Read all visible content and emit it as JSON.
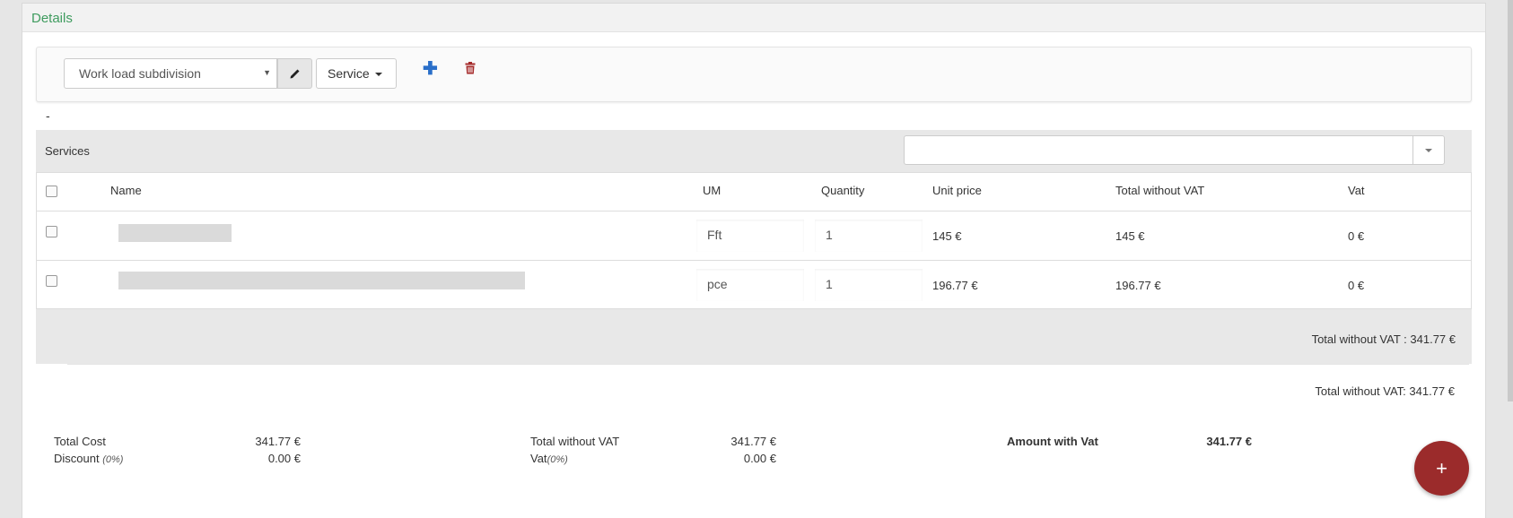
{
  "panel": {
    "title": "Details"
  },
  "toolbar": {
    "select_value": "Work load subdivision",
    "service_label": "Service",
    "icons": [
      "pencil-icon",
      "plus-icon",
      "trash-icon",
      "chevron-down-icon"
    ]
  },
  "dash": "-",
  "services": {
    "label": "Services",
    "search_value": ""
  },
  "table": {
    "headers": {
      "name": "Name",
      "um": "UM",
      "quantity": "Quantity",
      "unit_price": "Unit price",
      "total_without_vat": "Total without VAT",
      "vat": "Vat"
    },
    "rows": [
      {
        "um": "Fft",
        "quantity": "1",
        "unit_price": "145 €",
        "total": "145 €",
        "vat": "0 €"
      },
      {
        "um": "pce",
        "quantity": "1",
        "unit_price": "196.77 €",
        "total": "196.77 €",
        "vat": "0 €"
      }
    ]
  },
  "band_total": "Total without VAT : 341.77 €",
  "total_line2": "Total without VAT: 341.77 €",
  "summary": {
    "total_cost_label": "Total Cost",
    "total_cost_value": "341.77 €",
    "discount_label": "Discount",
    "discount_pct": "(0%)",
    "discount_value": "0.00 €",
    "total_wo_vat_label": "Total without VAT",
    "total_wo_vat_value": "341.77 €",
    "vat_label": "Vat",
    "vat_pct": "(0%)",
    "vat_value": "0.00 €",
    "amount_with_vat_label": "Amount with Vat",
    "amount_with_vat_value": "341.77 €"
  },
  "fab_label": "+",
  "colors": {
    "title_green": "#3f9c5f",
    "plus_blue": "#2a6fc9",
    "trash_red": "#a52a2a",
    "fab_red": "#9b2b2b"
  }
}
